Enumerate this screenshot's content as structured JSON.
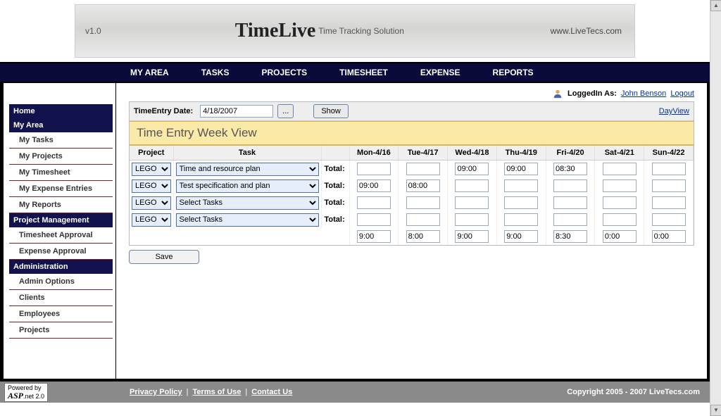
{
  "banner": {
    "version": "v1.0",
    "title": "TimeLive",
    "subtitle": "Time Tracking Solution",
    "url": "www.LiveTecs.com"
  },
  "topnav": [
    "MY AREA",
    "TASKS",
    "PROJECTS",
    "TIMESHEET",
    "EXPENSE",
    "REPORTS"
  ],
  "sidebar": [
    {
      "type": "head",
      "label": "Home"
    },
    {
      "type": "head",
      "label": "My Area"
    },
    {
      "type": "item",
      "label": "My Tasks"
    },
    {
      "type": "item",
      "label": "My Projects"
    },
    {
      "type": "item",
      "label": "My Timesheet"
    },
    {
      "type": "item",
      "label": "My Expense Entries"
    },
    {
      "type": "item",
      "label": "My Reports"
    },
    {
      "type": "head",
      "label": "Project Management"
    },
    {
      "type": "item",
      "label": "Timesheet Approval"
    },
    {
      "type": "item",
      "label": "Expense Approval"
    },
    {
      "type": "head",
      "label": "Administration"
    },
    {
      "type": "item",
      "label": "Admin Options"
    },
    {
      "type": "item",
      "label": "Clients"
    },
    {
      "type": "item",
      "label": "Employees"
    },
    {
      "type": "item",
      "label": "Projects"
    }
  ],
  "login": {
    "label": "LoggedIn As:",
    "user": "John Benson",
    "logout": "Logout"
  },
  "toolbar": {
    "date_label": "TimeEntry Date:",
    "date_value": "4/18/2007",
    "picker_label": "...",
    "show_label": "Show",
    "dayview_label": "DayView"
  },
  "view_title": "Time Entry Week View",
  "grid": {
    "columns": [
      "Project",
      "Task",
      "",
      "Mon-4/16",
      "Tue-4/17",
      "Wed-4/18",
      "Thu-4/19",
      "Fri-4/20",
      "Sat-4/21",
      "Sun-4/22"
    ],
    "rows": [
      {
        "project": "LEGO",
        "task": "Time and resource plan",
        "total": "Total:",
        "cells": [
          "",
          "",
          "09:00",
          "09:00",
          "08:30",
          "",
          ""
        ]
      },
      {
        "project": "LEGO",
        "task": "Test specification and plan",
        "total": "Total:",
        "cells": [
          "09:00",
          "08:00",
          "",
          "",
          "",
          "",
          ""
        ]
      },
      {
        "project": "LEGO",
        "task": "Select Tasks",
        "total": "Total:",
        "cells": [
          "",
          "",
          "",
          "",
          "",
          "",
          ""
        ]
      },
      {
        "project": "LEGO",
        "task": "Select Tasks",
        "total": "Total:",
        "cells": [
          "",
          "",
          "",
          "",
          "",
          "",
          ""
        ]
      }
    ],
    "totals": [
      "9:00",
      "8:00",
      "9:00",
      "9:00",
      "8:30",
      "0:00",
      "0:00"
    ],
    "save_label": "Save"
  },
  "footer": {
    "aspnet_top": "Powered by",
    "aspnet": "ASP.net 2.0",
    "links": [
      "Privacy Policy",
      "Terms of Use",
      "Contact Us"
    ],
    "copyright": "Copyright 2005 - 2007 LiveTecs.com"
  }
}
